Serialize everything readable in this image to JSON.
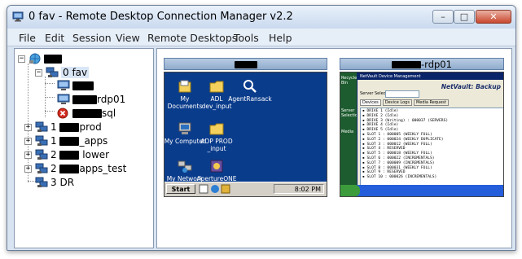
{
  "window": {
    "title": "0 fav - Remote Desktop Connection Manager v2.2",
    "controls": {
      "minimize": "–",
      "maximize": "□",
      "close": "✕"
    }
  },
  "menu": [
    "File",
    "Edit",
    "Session",
    "View",
    "Remote Desktops",
    "Tools",
    "Help"
  ],
  "tree": {
    "root": {
      "label": ""
    },
    "group_fav": {
      "label": "0 fav"
    },
    "fav_items": [
      {
        "prefix": "",
        "suffix": "",
        "icon": "computer-icon"
      },
      {
        "prefix": "",
        "suffix": "rdp01",
        "icon": "computer-icon"
      },
      {
        "prefix": "",
        "suffix": "sql",
        "icon": "error-icon"
      }
    ],
    "groups": [
      {
        "num": "1",
        "suffix": "prod"
      },
      {
        "num": "1",
        "suffix": "_apps"
      },
      {
        "num": "2",
        "suffix": "lower"
      },
      {
        "num": "2",
        "suffix": "apps_test"
      },
      {
        "num": "3",
        "suffix": "DR"
      }
    ]
  },
  "thumbnails": [
    {
      "header_suffix": "",
      "desktop_icons": [
        "My Documents",
        "ADL dev_input",
        "AgentRansack",
        "My Computer",
        "ADP PROD _input",
        "My Network Places",
        "ApertureONE Studio"
      ],
      "start_label": "Start",
      "clock": "8:02 PM"
    },
    {
      "header_suffix": "-rdp01",
      "app_window_title": "NetVault Device Management",
      "app_brand": "NetVault: Backup",
      "server_selection_label": "Server Selection",
      "tabs": [
        "Devices",
        "Device Logs",
        "Media Request"
      ],
      "side_items": [
        "Recycle Bin",
        "Server Selection",
        "Media"
      ],
      "drive_lines": [
        "DRIVE 1 (Idle)",
        "DRIVE 2 (Idle)",
        "DRIVE 3 (Writing) : 000037 (SERVERS)",
        "DRIVE 4 (Idle)",
        "DRIVE 5 (Idle)",
        "SLOT 1 : 000005 (WEEKLY FULL)",
        "SLOT 2 : 000024 (WEEKLY DUPLICATE)",
        "SLOT 3 : 000012 (WEEKLY FULL)",
        "SLOT 4 : RESERVED",
        "SLOT 5 : 000018 (WEEKLY FULL)",
        "SLOT 6 : 000022 (INCREMENTALS)",
        "SLOT 7 : 000009 (INCREMENTALS)",
        "SLOT 8 : 000031 (WEEKLY FULL)",
        "SLOT 9 : RESERVED",
        "SLOT 10 : 000026 (INCREMENTALS)"
      ]
    }
  ]
}
